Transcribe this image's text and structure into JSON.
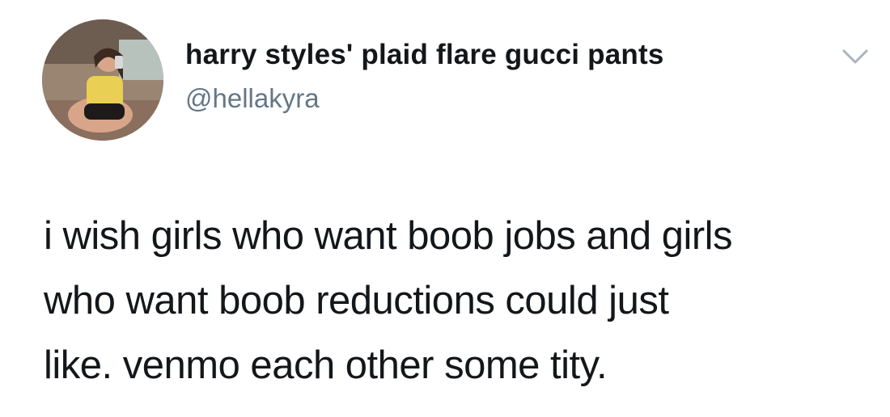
{
  "author": {
    "display_name": "harry styles' plaid flare gucci pants",
    "handle": "@hellakyra",
    "avatar_icon": "profile-photo"
  },
  "menu": {
    "icon": "chevron-down-icon"
  },
  "tweet": {
    "lines": [
      "i wish girls who want boob jobs and girls",
      "who want boob reductions could just",
      "like. venmo each other some tity."
    ]
  },
  "colors": {
    "text": "#14171a",
    "secondary": "#657786",
    "caret": "#a9b4bd"
  }
}
